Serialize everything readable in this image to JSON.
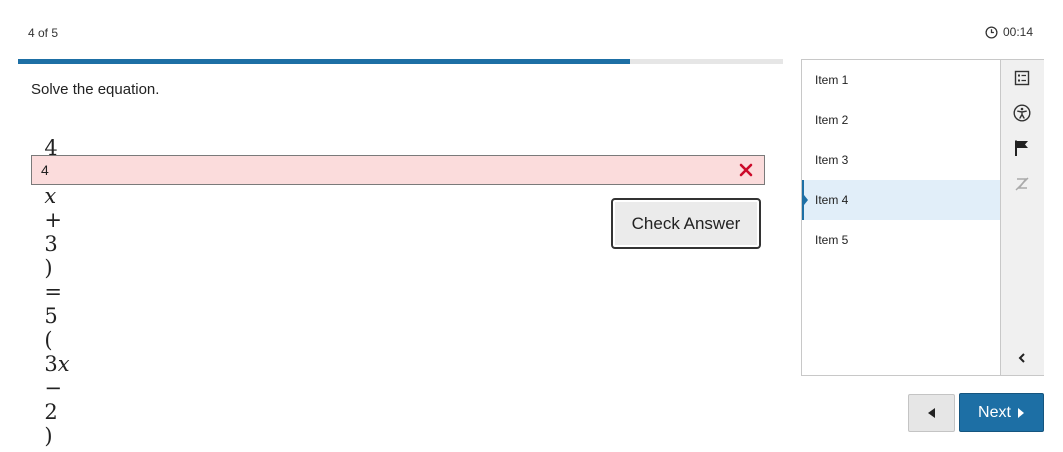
{
  "header": {
    "counter": "4 of 5",
    "timer": "00:14",
    "progress_fraction": 0.8
  },
  "question": {
    "prompt": "Solve the equation.",
    "equation_parts": [
      "4",
      "(",
      "x",
      "+",
      "3",
      ")",
      "=",
      "5",
      "(",
      "3",
      "x",
      "−",
      "2",
      ")"
    ],
    "answer_value": "4",
    "answer_status": "incorrect",
    "check_label": "Check Answer"
  },
  "sidebar": {
    "items": [
      {
        "label": "Item 1",
        "active": false
      },
      {
        "label": "Item 2",
        "active": false
      },
      {
        "label": "Item 3",
        "active": false
      },
      {
        "label": "Item 4",
        "active": true
      },
      {
        "label": "Item 5",
        "active": false
      }
    ],
    "tools": [
      "item-list-icon",
      "accessibility-icon",
      "flag-icon",
      "clear-format-icon",
      "chevron-left-icon"
    ]
  },
  "nav": {
    "next_label": "Next"
  },
  "colors": {
    "accent": "#1d6fa5",
    "incorrect_bg": "#fbdcdc",
    "incorrect_icon": "#cc0a2a",
    "active_item_bg": "#e1eef9"
  }
}
